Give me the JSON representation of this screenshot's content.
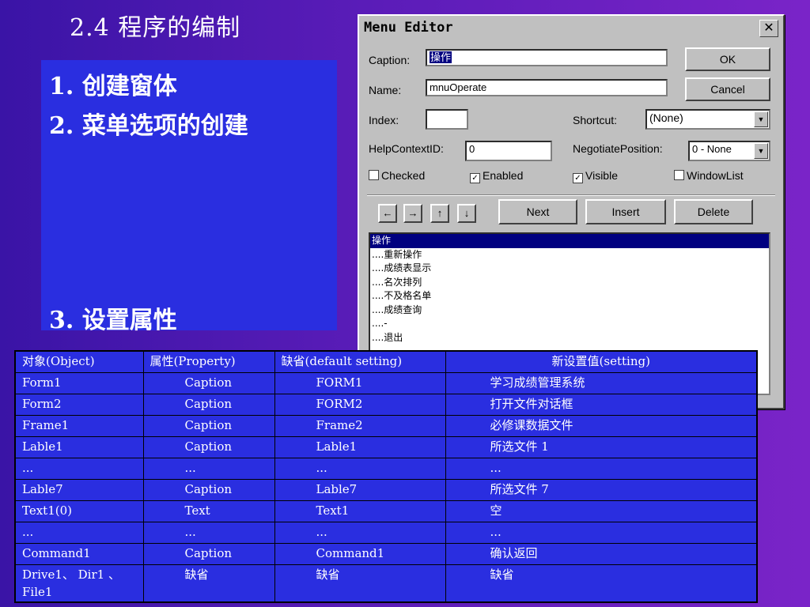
{
  "slide": {
    "title": "2.4  程序的编制",
    "bullets": [
      "1. 创建窗体",
      "2. 菜单选项的创建",
      "3. 设置属性"
    ]
  },
  "dialog": {
    "title": "Menu Editor",
    "caption_label": "Caption:",
    "caption_value": "操作",
    "name_label": "Name:",
    "name_value": "mnuOperate",
    "index_label": "Index:",
    "index_value": "",
    "shortcut_label": "Shortcut:",
    "shortcut_value": "(None)",
    "helpcontext_label": "HelpContextID:",
    "helpcontext_value": "0",
    "negotiate_label": "NegotiatePosition:",
    "negotiate_value": "0 - None",
    "ok_label": "OK",
    "cancel_label": "Cancel",
    "checked_label": "Checked",
    "enabled_label": "Enabled",
    "visible_label": "Visible",
    "windowlist_label": "WindowList",
    "checked": false,
    "enabled": true,
    "visible": true,
    "windowlist": false,
    "next_label": "Next",
    "insert_label": "Insert",
    "delete_label": "Delete",
    "menu_items": [
      "操作",
      "....重新操作",
      "....成绩表显示",
      "....名次排列",
      "....不及格名单",
      "....成绩查询",
      "....-",
      "....退出"
    ]
  },
  "table": {
    "headers": [
      "对象(Object)",
      "属性(Property)",
      "缺省(default setting)",
      "新设置值(setting)"
    ],
    "rows": [
      [
        "Form1",
        "Caption",
        "FORM1",
        "学习成绩管理系统"
      ],
      [
        "Form2",
        "Caption",
        "FORM2",
        "打开文件对话框"
      ],
      [
        "Frame1",
        "Caption",
        "Frame2",
        "必修课数据文件"
      ],
      [
        "Lable1",
        "Caption",
        "Lable1",
        "所选文件 1"
      ],
      [
        "...",
        "...",
        "...",
        "..."
      ],
      [
        "Lable7",
        "Caption",
        "Lable7",
        "所选文件 7"
      ],
      [
        "Text1(0)",
        "Text",
        "Text1",
        "空"
      ],
      [
        "...",
        "...",
        "...",
        "..."
      ],
      [
        "Command1",
        "Caption",
        "Command1",
        "确认返回"
      ],
      [
        "Drive1、 Dir1 、File1",
        "缺省",
        "缺省",
        "缺省"
      ]
    ]
  }
}
